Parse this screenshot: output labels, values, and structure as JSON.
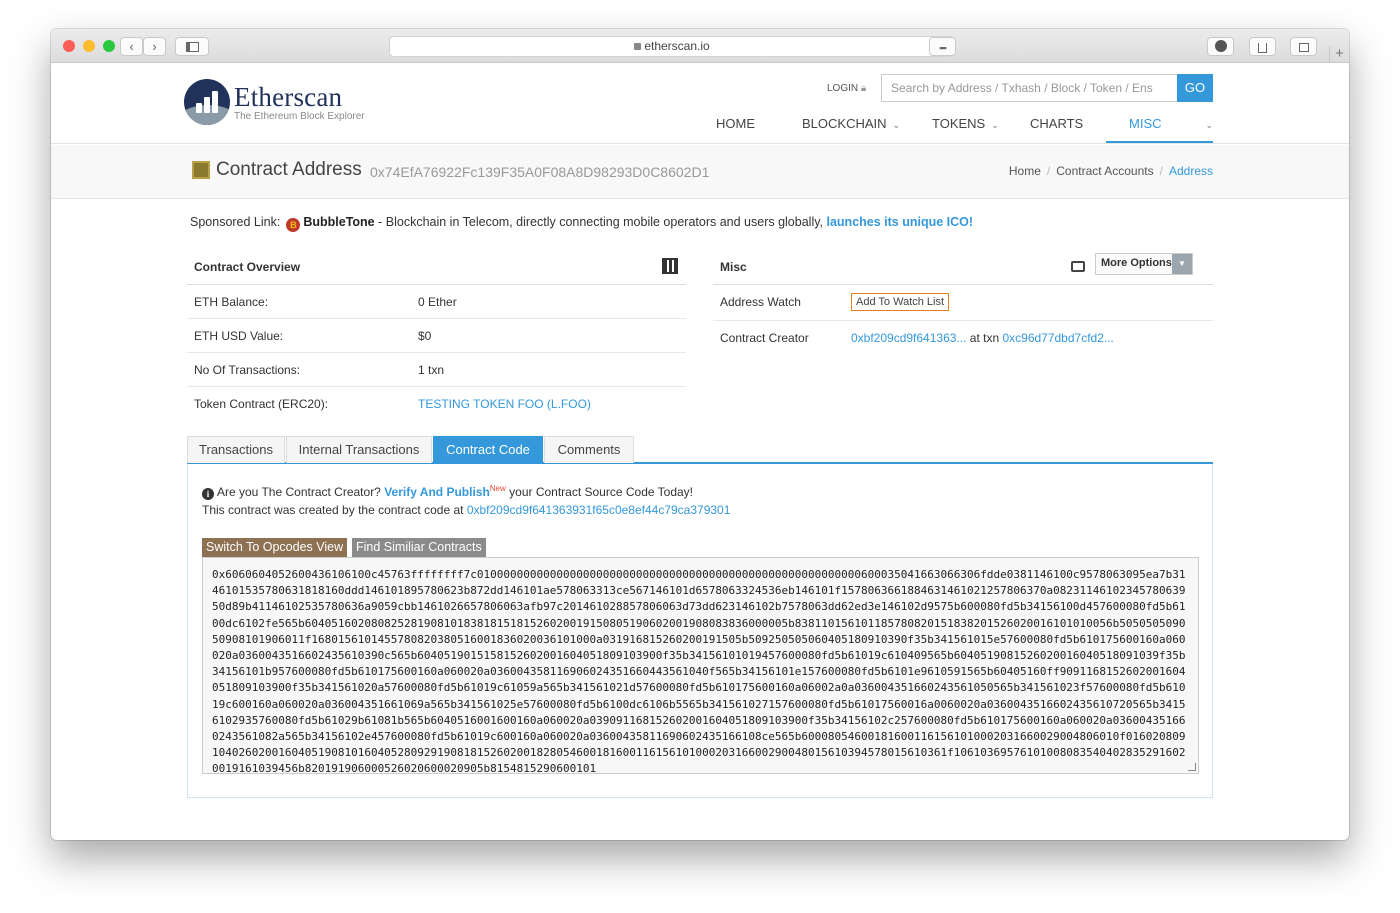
{
  "browser": {
    "url": "etherscan.io",
    "back_icon": "‹",
    "forward_icon": "›"
  },
  "header": {
    "logo_title": "Etherscan",
    "logo_subtitle": "The Ethereum Block Explorer",
    "login": "LOGIN",
    "search_placeholder": "Search by Address / Txhash / Block / Token / Ens",
    "go": "GO",
    "nav": [
      "HOME",
      "BLOCKCHAIN",
      "TOKENS",
      "CHARTS",
      "MISC"
    ]
  },
  "page": {
    "title": "Contract Address",
    "address": "0x74EfA76922Fc139F35A0F08A8D98293D0C8602D1",
    "breadcrumb": [
      "Home",
      "Contract Accounts",
      "Address"
    ]
  },
  "sponsor": {
    "label": "Sponsored Link:",
    "name": "BubbleTone",
    "text": " - Blockchain in Telecom, directly connecting mobile operators and users globally, ",
    "link": "launches its unique ICO!"
  },
  "overview": {
    "title": "Contract Overview",
    "rows": [
      {
        "label": "ETH Balance:",
        "value": "0 Ether"
      },
      {
        "label": "ETH USD Value:",
        "value": "$0"
      },
      {
        "label": "No Of Transactions:",
        "value": "1 txn"
      },
      {
        "label": "Token Contract (ERC20):",
        "value": "TESTING TOKEN FOO (L.FOO)"
      }
    ]
  },
  "misc": {
    "title": "Misc",
    "more_options": "More Options",
    "address_watch_label": "Address Watch",
    "watch_button": "Add To Watch List",
    "creator_label": "Contract Creator",
    "creator_addr": "0xbf209cd9f641363...",
    "at_txn": " at txn ",
    "creator_txn": "0xc96d77dbd7cfd2..."
  },
  "tabs": [
    "Transactions",
    "Internal Transactions",
    "Contract Code",
    "Comments"
  ],
  "code_tab": {
    "question": "Are you The Contract Creator?",
    "verify_link": "Verify And Publish",
    "new_badge": "New",
    "question_tail": "your Contract Source Code Today!",
    "created_text": "This contract was created by the contract code at",
    "created_addr": "0xbf209cd9f641363931f65c0e8ef44c79ca379301",
    "btn_opcodes": "Switch To Opcodes View",
    "btn_similar": "Find Similiar Contracts",
    "bytecode": "0x6060604052600436106100c45763ffffffff7c0100000000000000000000000000000000000000000000000000000000600035041663066306fdde0381146100c9578063095ea7b3146101535780631818160ddd146101895780623b872dd146101ae578063313ce567146101d6578063324536eb146101f1578063661884631461021257806370a0823114610234578063950d89b41146102535780636a9059cbb1461026657806063afb97c201461028857806063d73dd623146102b7578063dd62ed3e146102d9575b600080fd5b34156100d457600080fd5b6100dc6102fe565b6040516020808252819081018381815181526020019150805190602001908083836000005b838110156101185780820151838201526020016101010056b505050509050908101906011f1680156101455780820380516001836020036101000a031916815260200191505b509250505060405180910390f35b341561015e57600080fd5b610175600160a060020a0360043516602435610390c565b6040519015158152602001604051809103900f35b34156101019457600080fd5b61019c610409565b6040519081526020016040518091039f35b34156101b957600080fd5b610175600160a060020a036004358116906024351660443561040f565b34156101e157600080fd5b6101e9610591565b60405160ff9091168152602001604051809103900f35b341561020a57600080fd5b61019c61059a565b341561021d57600080fd5b610175600160a06002a0a036004351660243561050565b341561023f57600080fd5b61019c600160a060020a036004351661069a565b341561025e57600080fd5b6100dc6106b5565b341561027157600080fd5b61017560016a0060020a0360043516602435610720565b34156102935760080fd5b61029b61081b565b6040516001600160a060020a039091168152602001604051809103900f35b34156102c257600080fd5b610175600160a060020a036004351660243561082a565b34156102e457600080fd5b61019c600160a060020a03600435811690602435166108ce565b600080546001816001161561010002031660029004806010f016020809104026020016040519081016040528092919081815260200182805460018160011615610100020316600290048015610394578015610361f106103695761010080835404028352916020019161039456b820191906000526020600020905b8154815290600101"
  }
}
